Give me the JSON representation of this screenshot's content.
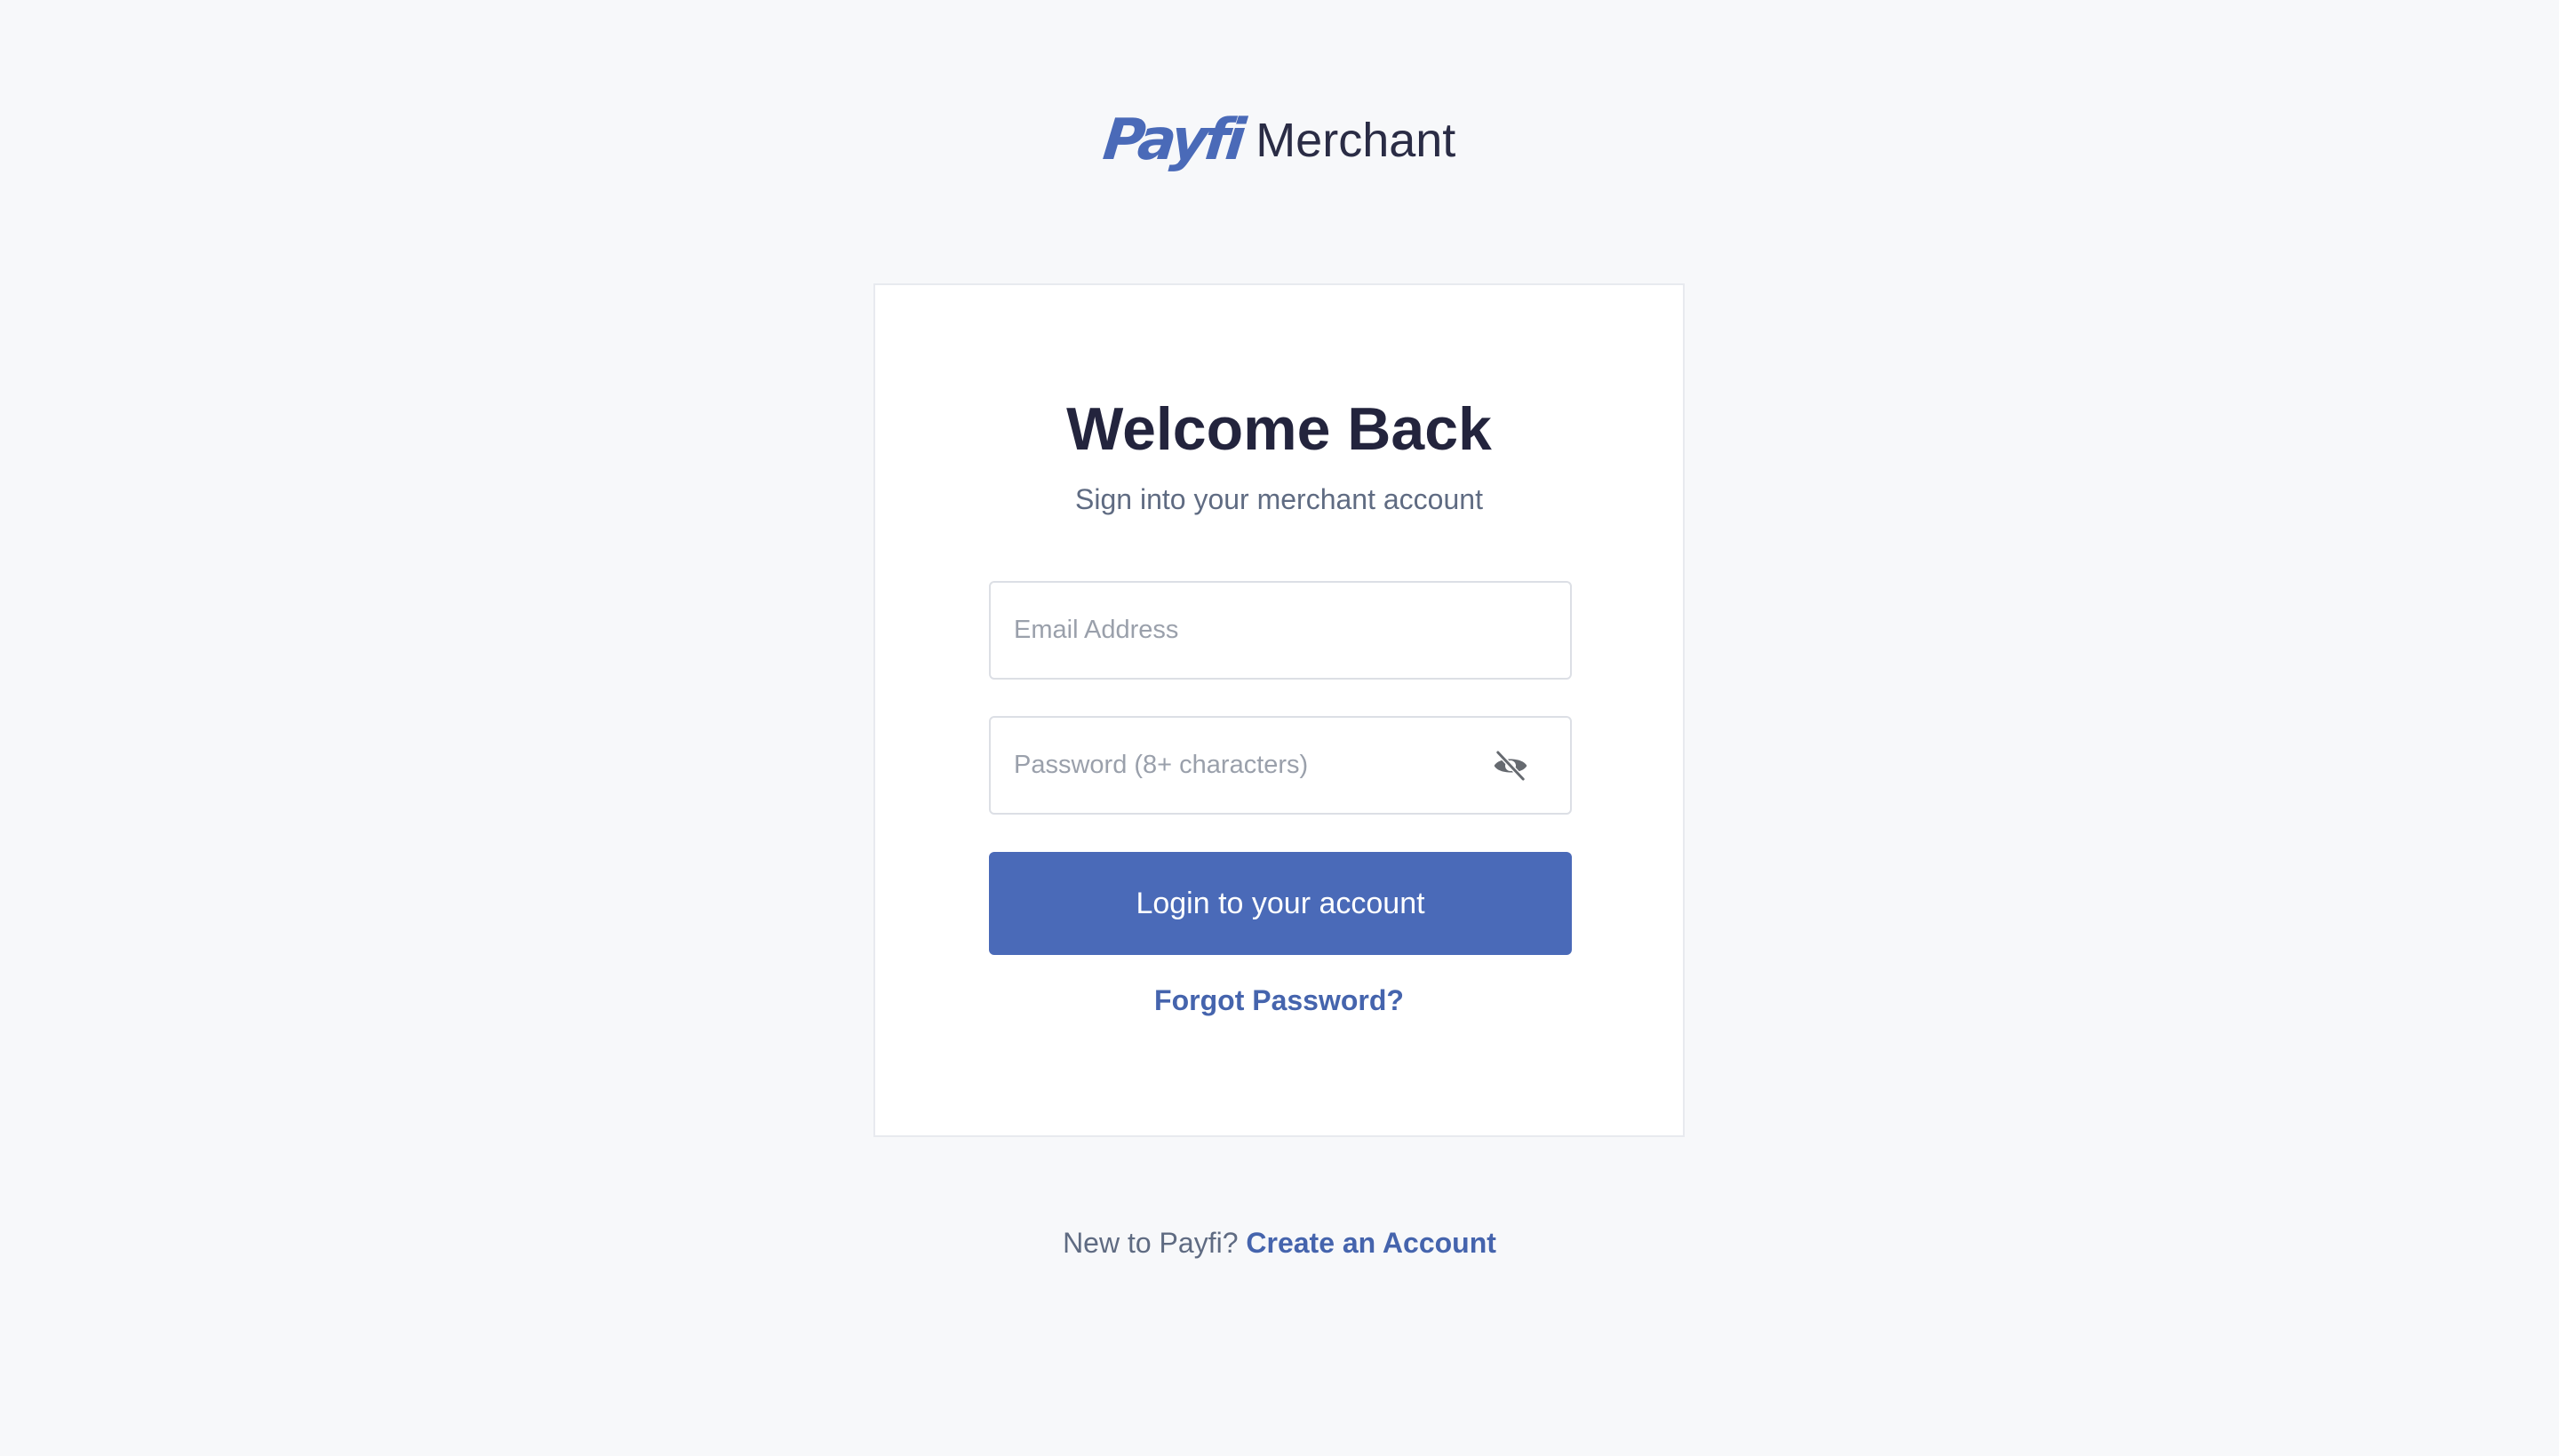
{
  "brand": {
    "logo_text": "Payfi",
    "product_name": "Merchant"
  },
  "login_card": {
    "title": "Welcome Back",
    "subtitle": "Sign into your merchant account",
    "email": {
      "value": "",
      "placeholder": "Email Address"
    },
    "password": {
      "value": "",
      "placeholder": "Password (8+ characters)",
      "toggle_icon": "eye-off-icon"
    },
    "login_button_label": "Login to your account",
    "forgot_password_label": "Forgot Password?"
  },
  "footer": {
    "prompt_text": "New to Payfi?",
    "create_account_label": "Create an Account"
  },
  "colors": {
    "page_background": "#f7f8fa",
    "card_background": "#ffffff",
    "accent": "#4a6ab8",
    "title_text": "#23243d",
    "muted_text": "#5f6b82",
    "placeholder_text": "#9aa0ab",
    "input_border": "#dcdfe5"
  }
}
